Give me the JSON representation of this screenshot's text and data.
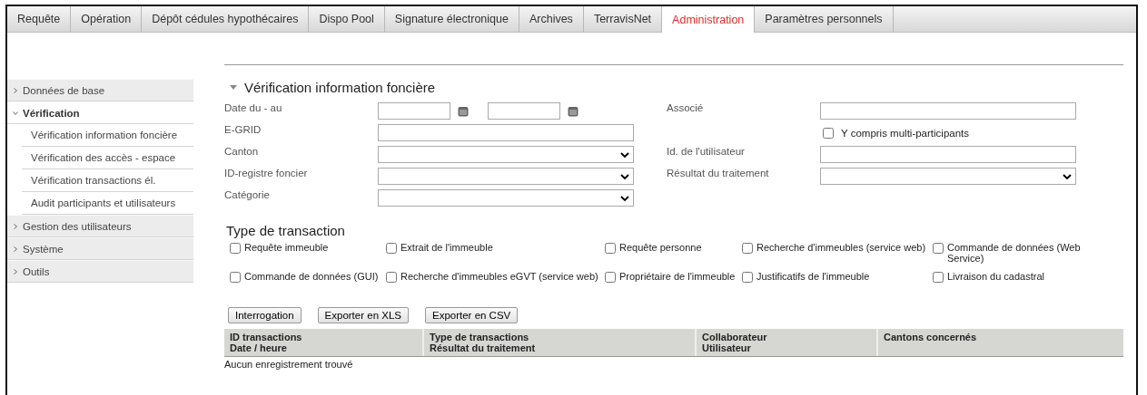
{
  "tabs": [
    {
      "label": "Requête",
      "selected": false
    },
    {
      "label": "Opération",
      "selected": false
    },
    {
      "label": "Dépôt cédules hypothécaires",
      "selected": false
    },
    {
      "label": "Dispo Pool",
      "selected": false
    },
    {
      "label": "Signature électronique",
      "selected": false
    },
    {
      "label": "Archives",
      "selected": false
    },
    {
      "label": "TerravisNet",
      "selected": false
    },
    {
      "label": "Administration",
      "selected": true
    },
    {
      "label": "Paramètres personnels",
      "selected": false
    }
  ],
  "sidebar": {
    "items": [
      {
        "label": "Données de base",
        "expanded": false
      },
      {
        "label": "Vérification",
        "expanded": true,
        "children": [
          {
            "label": "Vérification information foncière"
          },
          {
            "label": "Vérification des accès - espace"
          },
          {
            "label": "Vérification transactions él."
          },
          {
            "label": "Audit participants et utilisateurs"
          }
        ]
      },
      {
        "label": "Gestion des utilisateurs",
        "expanded": false
      },
      {
        "label": "Système",
        "expanded": false
      },
      {
        "label": "Outils",
        "expanded": false
      }
    ]
  },
  "section": {
    "title": "Vérification information foncière",
    "expanded": true
  },
  "form": {
    "left": [
      {
        "label": "Date du - au",
        "kind": "daterange"
      },
      {
        "label": "E-GRID",
        "kind": "text"
      },
      {
        "label": "Canton",
        "kind": "select"
      },
      {
        "label": "ID-registre foncier",
        "kind": "select"
      },
      {
        "label": "Catégorie",
        "kind": "select"
      }
    ],
    "right": [
      {
        "label": "Associé",
        "kind": "text"
      },
      {
        "label": "Y compris multi-participants",
        "kind": "checkbox",
        "checked": false
      },
      {
        "label": "Id. de l'utilisateur",
        "kind": "text"
      },
      {
        "label": "Résultat du traitement",
        "kind": "select"
      }
    ]
  },
  "transaction_types": {
    "title": "Type de transaction",
    "items": [
      {
        "label": "Requête immeuble",
        "checked": false
      },
      {
        "label": "Extrait de l'immeuble",
        "checked": false
      },
      {
        "label": "Requête personne",
        "checked": false
      },
      {
        "label": "Recherche d'immeubles (service web)",
        "checked": false
      },
      {
        "label": "Commande de données (Web Service)",
        "checked": false
      },
      {
        "label": "Commande de données (GUI)",
        "checked": false
      },
      {
        "label": "Recherche d'immeubles eGVT (service web)",
        "checked": false
      },
      {
        "label": "Propriétaire de l'immeuble",
        "checked": false
      },
      {
        "label": "Justificatifs de l'immeuble",
        "checked": false
      },
      {
        "label": "Livraison du cadastral",
        "checked": false
      }
    ]
  },
  "buttons": [
    "Interrogation",
    "Exporter en XLS",
    "Exporter en CSV"
  ],
  "table": {
    "columns": [
      [
        "ID transactions",
        "Date / heure"
      ],
      [
        "Type de transactions",
        "Résultat du traitement"
      ],
      [
        "Collaborateur",
        "Utilisateur"
      ],
      [
        "Cantons concernés"
      ]
    ],
    "empty_message": "Aucun enregistrement trouvé"
  }
}
